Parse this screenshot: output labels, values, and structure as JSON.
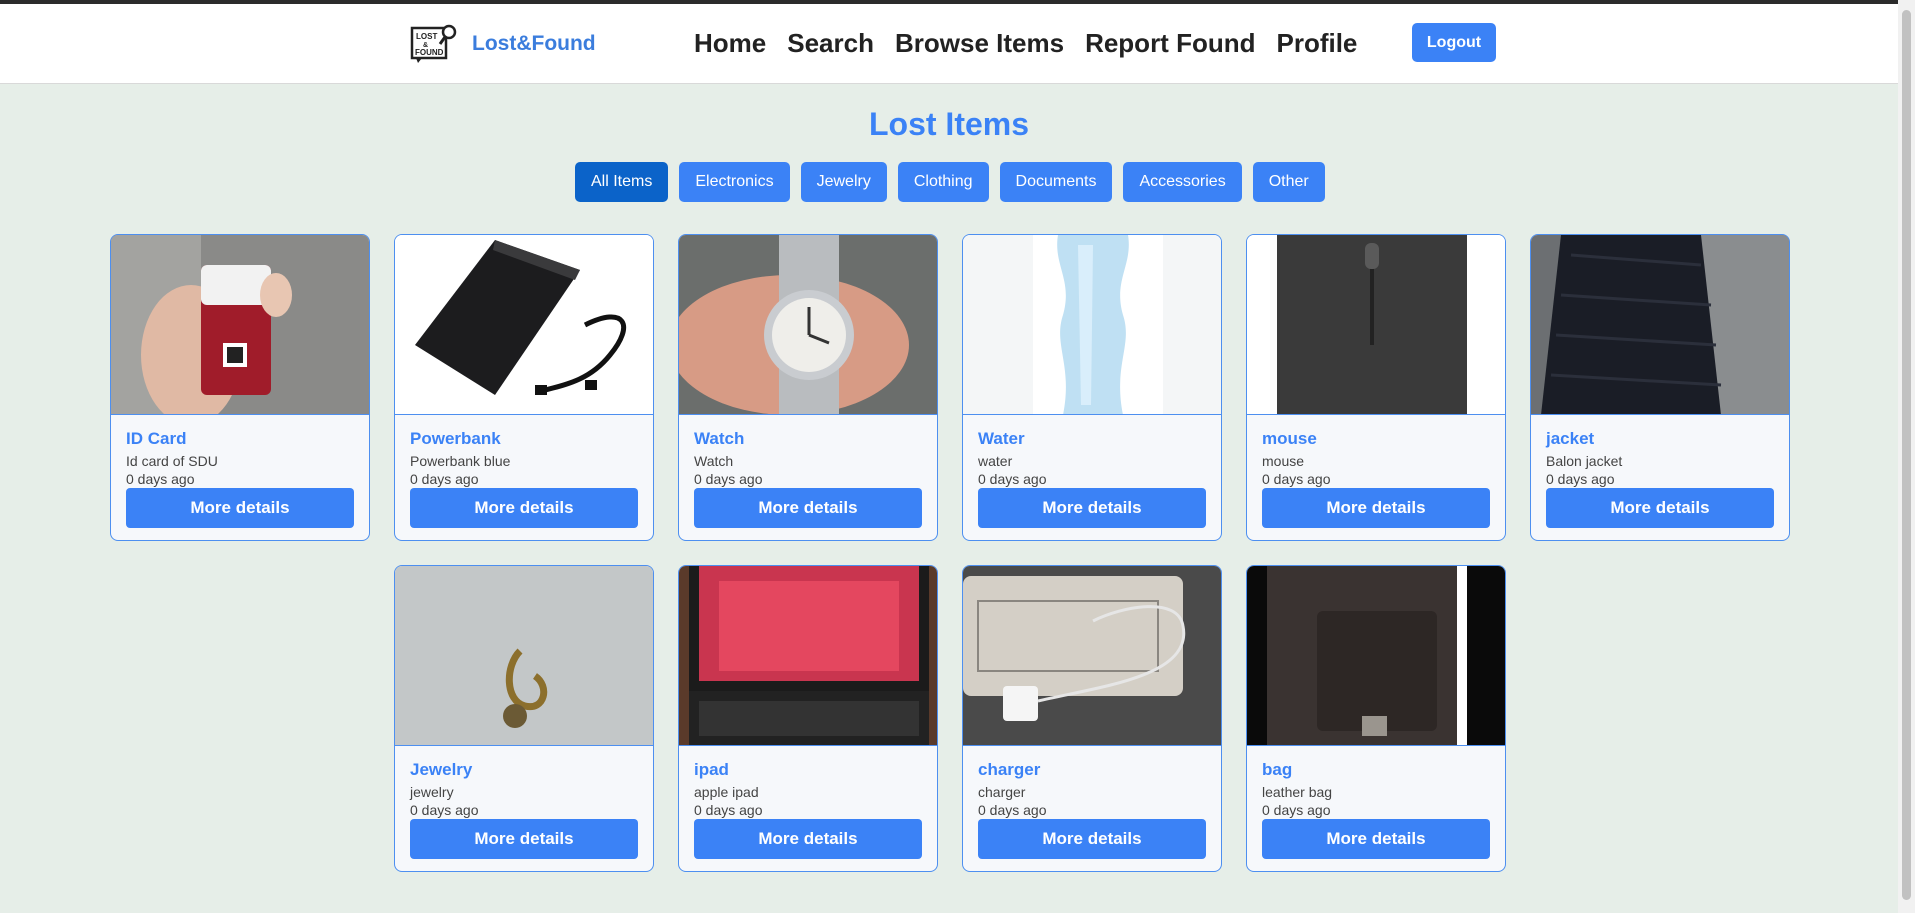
{
  "header": {
    "brand": "Lost&Found",
    "logo_text": "LOST & FOUND",
    "nav": [
      "Home",
      "Search",
      "Browse Items",
      "Report Found",
      "Profile"
    ],
    "logout": "Logout"
  },
  "page": {
    "title": "Lost Items",
    "filters": [
      "All Items",
      "Electronics",
      "Jewelry",
      "Clothing",
      "Documents",
      "Accessories",
      "Other"
    ],
    "active_filter": "All Items"
  },
  "items": [
    {
      "title": "ID Card",
      "desc": "Id card of SDU",
      "date": "0 days ago",
      "button": "More details",
      "image": "id-card-photo"
    },
    {
      "title": "Powerbank",
      "desc": "Powerbank blue",
      "date": "0 days ago",
      "button": "More details",
      "image": "powerbank-photo"
    },
    {
      "title": "Watch",
      "desc": "Watch",
      "date": "0 days ago",
      "button": "More details",
      "image": "watch-photo"
    },
    {
      "title": "Water",
      "desc": "water",
      "date": "0 days ago",
      "button": "More details",
      "image": "water-bottle-photo"
    },
    {
      "title": "mouse",
      "desc": "mouse",
      "date": "0 days ago",
      "button": "More details",
      "image": "mouse-photo"
    },
    {
      "title": "jacket",
      "desc": "Balon jacket",
      "date": "0 days ago",
      "button": "More details",
      "image": "jacket-photo"
    },
    {
      "title": "Jewelry",
      "desc": "jewelry",
      "date": "0 days ago",
      "button": "More details",
      "image": "earring-photo"
    },
    {
      "title": "ipad",
      "desc": "apple ipad",
      "date": "0 days ago",
      "button": "More details",
      "image": "ipad-photo"
    },
    {
      "title": "charger",
      "desc": "charger",
      "date": "0 days ago",
      "button": "More details",
      "image": "charger-photo"
    },
    {
      "title": "bag",
      "desc": "leather bag",
      "date": "0 days ago",
      "button": "More details",
      "image": "bag-photo"
    }
  ],
  "colors": {
    "accent": "#3b82f6",
    "active_filter": "#0b63c9",
    "background": "#e6eee8"
  }
}
